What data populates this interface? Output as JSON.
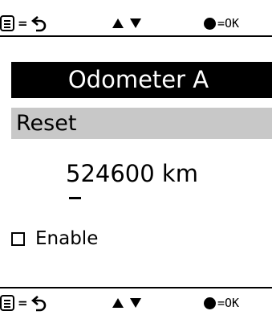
{
  "hint_bar": {
    "equals": "=",
    "ok_label": "=OK",
    "up_arrow_icon": "triangle-up-icon",
    "down_arrow_icon": "triangle-down-icon",
    "menu_icon": "menu-icon",
    "back_icon": "back-arrow-icon",
    "select_icon": "filled-dot-icon"
  },
  "screen": {
    "title": "Odometer A",
    "selected_item": "Reset",
    "value": "524600 km",
    "checkbox": {
      "label": "Enable",
      "checked": false
    }
  },
  "colors": {
    "title_background": "#000000",
    "title_text": "#ffffff",
    "selection_highlight": "#c8c8c8",
    "background": "#ffffff"
  }
}
